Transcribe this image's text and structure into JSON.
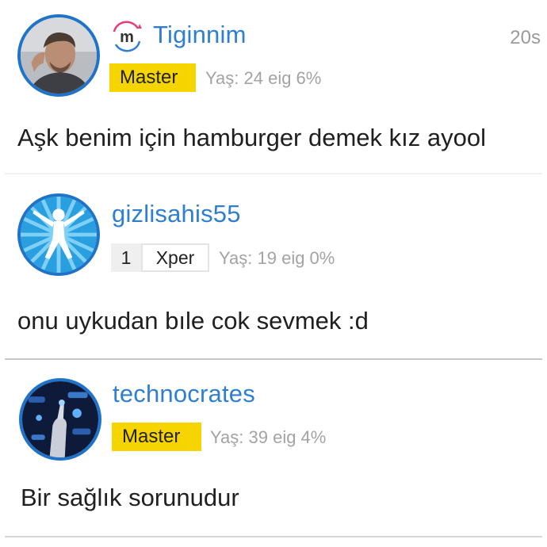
{
  "comments": [
    {
      "username": "Tiginnim",
      "badge_icon": "m-logo-icon",
      "time": "20s",
      "rank": "Master",
      "meta": "Yaş: 24 eig 6%",
      "text": "Aşk benim için hamburger demek kız ayool"
    },
    {
      "username": "gizlisahis55",
      "xper_level": "1",
      "xper_label": "Xper",
      "meta": "Yaş: 19 eig 0%",
      "text": "onu uykudan bıle cok sevmek :d"
    },
    {
      "username": "technocrates",
      "rank": "Master",
      "meta": "Yaş: 39 eig 4%",
      "text": "Bir sağlık sorunudur"
    }
  ],
  "colors": {
    "username": "#2f7fd0",
    "avatar_border": "#1f74c9",
    "master_badge": "#f5d400",
    "meta_text": "#a3a3a3"
  }
}
